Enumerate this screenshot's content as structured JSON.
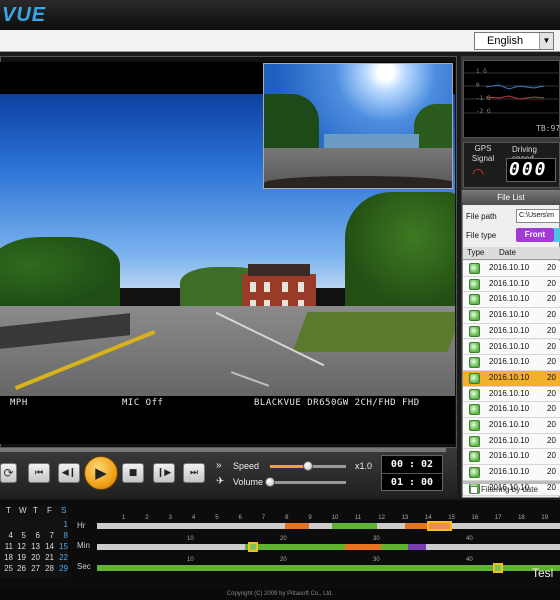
{
  "app": {
    "logo": "VUE"
  },
  "toolbar": {
    "language": "English"
  },
  "video": {
    "overlay_left": "MPH",
    "overlay_mid": "MIC Off",
    "overlay_right": "BLACKVUE DR650GW 2CH/FHD FHD"
  },
  "controls": {
    "speed_label": "Speed",
    "speed_value": "x1.0",
    "speed_level": 0.5,
    "volume_label": "Volume",
    "volume_level": 0.0,
    "time_current": "00 : 02",
    "time_total": "01 : 00"
  },
  "gps": {
    "signal_label": "GPS Signal",
    "speed_label": "Driving speed",
    "speed_value": "000",
    "tb": "TB:97"
  },
  "graph": {
    "labels": [
      "1 G",
      "0",
      "-1 G",
      "-2 G"
    ]
  },
  "filelist": {
    "title": "File List",
    "path_label": "File path",
    "path_value": "C:\\Users\\m",
    "type_label": "File type",
    "front_label": "Front",
    "col_type": "Type",
    "col_date": "Date",
    "rows": [
      {
        "date": "2016.10.10",
        "time": "20"
      },
      {
        "date": "2016.10.10",
        "time": "20"
      },
      {
        "date": "2016.10.10",
        "time": "20"
      },
      {
        "date": "2016.10.10",
        "time": "20"
      },
      {
        "date": "2016.10.10",
        "time": "20"
      },
      {
        "date": "2016.10.10",
        "time": "20"
      },
      {
        "date": "2016.10.10",
        "time": "20"
      },
      {
        "date": "2016.10.10",
        "time": "20"
      },
      {
        "date": "2016.10.10",
        "time": "20"
      },
      {
        "date": "2016.10.10",
        "time": "20"
      },
      {
        "date": "2016.10.10",
        "time": "20"
      },
      {
        "date": "2016.10.10",
        "time": "20"
      },
      {
        "date": "2016.10.10",
        "time": "20"
      },
      {
        "date": "2016.10.10",
        "time": "20"
      },
      {
        "date": "2016.10.10",
        "time": "20"
      }
    ],
    "selected_index": 7,
    "filter_label": "Filtering by date"
  },
  "calendar": {
    "headers": [
      "T",
      "W",
      "T",
      "F",
      "S"
    ],
    "weeks": [
      [
        "",
        "",
        "",
        "",
        "1"
      ],
      [
        "4",
        "5",
        "6",
        "7",
        "8"
      ],
      [
        "11",
        "12",
        "13",
        "14",
        "15"
      ],
      [
        "18",
        "19",
        "20",
        "21",
        "22"
      ],
      [
        "25",
        "26",
        "27",
        "28",
        "29"
      ]
    ]
  },
  "timeline": {
    "hr_label": "Hr",
    "min_label": "Min",
    "sec_label": "Sec",
    "hr_ticks": [
      "1",
      "2",
      "3",
      "4",
      "5",
      "6",
      "7",
      "8",
      "9",
      "10",
      "11",
      "12",
      "13",
      "14",
      "15",
      "16",
      "17",
      "18",
      "19"
    ],
    "min_ticks": [
      "10",
      "20",
      "30",
      "40"
    ],
    "sec_ticks": [
      "10",
      "20",
      "30",
      "40"
    ],
    "colors": {
      "orange": "#e8741f",
      "green": "#5fb32e",
      "purple": "#7a3fb3",
      "track": "#cccccc"
    }
  },
  "footer": {
    "tesla": "Tesl",
    "copyright": "Copyright (C) 2009 by Pittasoft Co., Ltd."
  }
}
